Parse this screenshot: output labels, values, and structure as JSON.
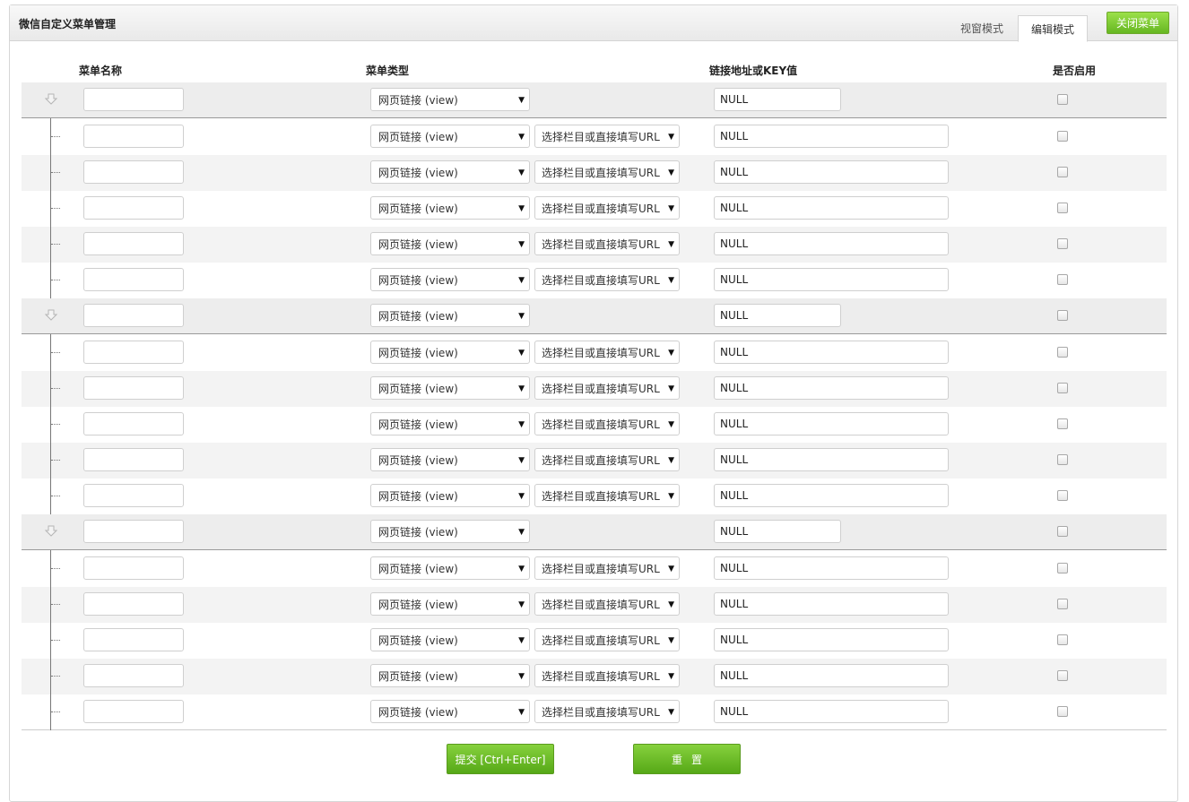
{
  "panel": {
    "title": "微信自定义菜单管理"
  },
  "tabs": {
    "view": "视窗模式",
    "edit": "编辑模式"
  },
  "close_button": "关闭菜单",
  "columns": {
    "name": "菜单名称",
    "type": "菜单类型",
    "link": "链接地址或KEY值",
    "enabled": "是否启用"
  },
  "defaults": {
    "type_value": "网页链接 (view)",
    "column_select": "选择栏目或直接填写URL",
    "url_value": "NULL"
  },
  "groups": [
    {
      "parent": {
        "name": "",
        "type": "网页链接 (view)",
        "url": "NULL",
        "enabled": false
      },
      "children": [
        {
          "name": "",
          "type": "网页链接 (view)",
          "column": "选择栏目或直接填写URL",
          "url": "NULL",
          "enabled": false
        },
        {
          "name": "",
          "type": "网页链接 (view)",
          "column": "选择栏目或直接填写URL",
          "url": "NULL",
          "enabled": false
        },
        {
          "name": "",
          "type": "网页链接 (view)",
          "column": "选择栏目或直接填写URL",
          "url": "NULL",
          "enabled": false
        },
        {
          "name": "",
          "type": "网页链接 (view)",
          "column": "选择栏目或直接填写URL",
          "url": "NULL",
          "enabled": false
        },
        {
          "name": "",
          "type": "网页链接 (view)",
          "column": "选择栏目或直接填写URL",
          "url": "NULL",
          "enabled": false
        }
      ]
    },
    {
      "parent": {
        "name": "",
        "type": "网页链接 (view)",
        "url": "NULL",
        "enabled": false
      },
      "children": [
        {
          "name": "",
          "type": "网页链接 (view)",
          "column": "选择栏目或直接填写URL",
          "url": "NULL",
          "enabled": false
        },
        {
          "name": "",
          "type": "网页链接 (view)",
          "column": "选择栏目或直接填写URL",
          "url": "NULL",
          "enabled": false
        },
        {
          "name": "",
          "type": "网页链接 (view)",
          "column": "选择栏目或直接填写URL",
          "url": "NULL",
          "enabled": false
        },
        {
          "name": "",
          "type": "网页链接 (view)",
          "column": "选择栏目或直接填写URL",
          "url": "NULL",
          "enabled": false
        },
        {
          "name": "",
          "type": "网页链接 (view)",
          "column": "选择栏目或直接填写URL",
          "url": "NULL",
          "enabled": false
        }
      ]
    },
    {
      "parent": {
        "name": "",
        "type": "网页链接 (view)",
        "url": "NULL",
        "enabled": false
      },
      "children": [
        {
          "name": "",
          "type": "网页链接 (view)",
          "column": "选择栏目或直接填写URL",
          "url": "NULL",
          "enabled": false
        },
        {
          "name": "",
          "type": "网页链接 (view)",
          "column": "选择栏目或直接填写URL",
          "url": "NULL",
          "enabled": false
        },
        {
          "name": "",
          "type": "网页链接 (view)",
          "column": "选择栏目或直接填写URL",
          "url": "NULL",
          "enabled": false
        },
        {
          "name": "",
          "type": "网页链接 (view)",
          "column": "选择栏目或直接填写URL",
          "url": "NULL",
          "enabled": false
        },
        {
          "name": "",
          "type": "网页链接 (view)",
          "column": "选择栏目或直接填写URL",
          "url": "NULL",
          "enabled": false
        }
      ]
    }
  ],
  "buttons": {
    "submit": "提交 [Ctrl+Enter]",
    "reset": "重置"
  },
  "colors": {
    "accent_green": "#66b722",
    "parent_row_bg": "#ededed",
    "alt_row_bg": "#f3f3f3"
  }
}
